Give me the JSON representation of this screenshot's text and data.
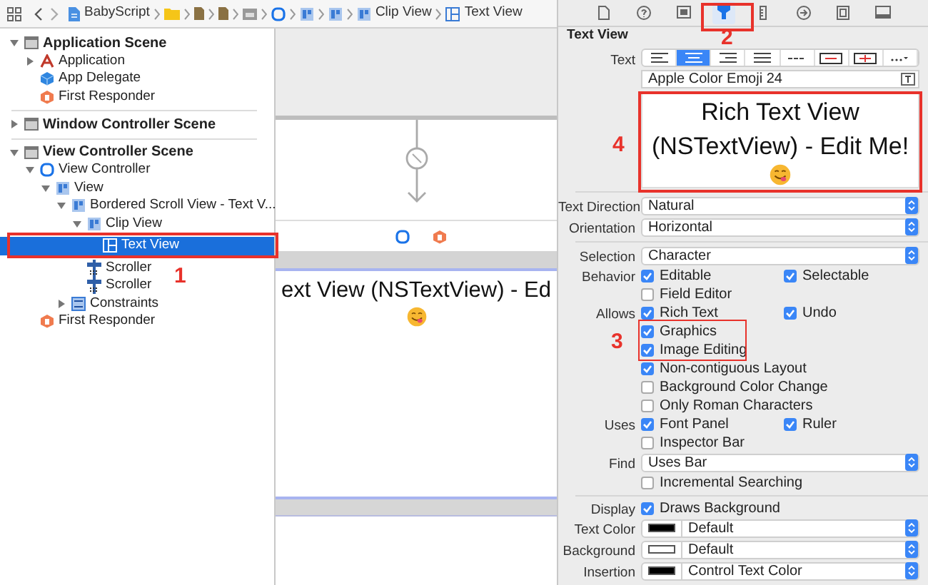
{
  "breadcrumbs": [
    {
      "kind": "project",
      "label": "BabyScript"
    },
    {
      "kind": "folder"
    },
    {
      "kind": "file"
    },
    {
      "kind": "file"
    },
    {
      "kind": "storyboard"
    },
    {
      "kind": "controller"
    },
    {
      "kind": "view"
    },
    {
      "kind": "view"
    },
    {
      "kind": "view",
      "label": "Clip View"
    },
    {
      "kind": "textview",
      "label": "Text View"
    }
  ],
  "outline": [
    {
      "label": "Application Scene",
      "kind": "scene",
      "expanded": true,
      "selected": false,
      "children": [
        {
          "label": "Application",
          "kind": "app",
          "expanded": false,
          "selected": false
        },
        {
          "label": "App Delegate",
          "kind": "cube",
          "selected": false
        },
        {
          "label": "First Responder",
          "kind": "responder",
          "selected": false
        }
      ]
    },
    {
      "label": "Window Controller Scene",
      "kind": "scene",
      "expanded": false,
      "selected": false
    },
    {
      "label": "View Controller Scene",
      "kind": "scene",
      "expanded": true,
      "selected": false,
      "children": [
        {
          "label": "View Controller",
          "kind": "controller",
          "expanded": true,
          "selected": false,
          "children": [
            {
              "label": "View",
              "kind": "view",
              "expanded": true,
              "selected": false,
              "children": [
                {
                  "label": "Bordered Scroll View - Text V...",
                  "kind": "view",
                  "expanded": true,
                  "selected": false,
                  "children": [
                    {
                      "label": "Clip View",
                      "kind": "view",
                      "expanded": true,
                      "selected": false,
                      "children": [
                        {
                          "label": "Text View",
                          "kind": "textview",
                          "selected": true
                        }
                      ]
                    },
                    {
                      "label": "Scroller",
                      "kind": "scroller",
                      "selected": false
                    },
                    {
                      "label": "Scroller",
                      "kind": "scroller",
                      "selected": false
                    }
                  ]
                },
                {
                  "label": "Constraints",
                  "kind": "constraints",
                  "expanded": false,
                  "selected": false
                }
              ]
            }
          ]
        },
        {
          "label": "First Responder",
          "kind": "responder",
          "selected": false
        }
      ]
    }
  ],
  "canvas": {
    "text": "ext View (NSTextView) - Ed"
  },
  "inspector": {
    "tabs": [
      {
        "kind": "file",
        "selected": false
      },
      {
        "kind": "help",
        "selected": false
      },
      {
        "kind": "identity",
        "selected": false
      },
      {
        "kind": "attributes",
        "selected": true
      },
      {
        "kind": "size",
        "selected": false
      },
      {
        "kind": "connections",
        "selected": false
      },
      {
        "kind": "bindings",
        "selected": false
      },
      {
        "kind": "effects",
        "selected": false
      }
    ],
    "title": "Text View",
    "text_label": "Text",
    "alignment": [
      {
        "kind": "left",
        "selected": false
      },
      {
        "kind": "center",
        "selected": true
      },
      {
        "kind": "right",
        "selected": false
      },
      {
        "kind": "justify",
        "selected": false
      },
      {
        "kind": "natural",
        "selected": false
      },
      {
        "kind": "strike",
        "selected": false
      },
      {
        "kind": "underline",
        "selected": false
      },
      {
        "kind": "more",
        "selected": false
      }
    ],
    "font": "Apple Color Emoji 24",
    "preview": [
      "Rich Text View",
      "(NSTextView) - Edit Me!"
    ],
    "sections": [
      {
        "rows": [
          {
            "kind": "popup",
            "label": "Text Direction",
            "value": "Natural"
          },
          {
            "kind": "popup",
            "label": "Orientation",
            "value": "Horizontal"
          }
        ]
      },
      {
        "rows": [
          {
            "kind": "popup",
            "label": "Selection",
            "value": "Character"
          },
          {
            "kind": "checks",
            "label": "Behavior",
            "items": [
              {
                "label": "Editable",
                "checked": true
              },
              {
                "label": "Selectable",
                "checked": true
              }
            ]
          },
          {
            "kind": "checks",
            "items": [
              {
                "label": "Field Editor",
                "checked": false
              }
            ]
          },
          {
            "kind": "checks",
            "label": "Allows",
            "items": [
              {
                "label": "Rich Text",
                "checked": true
              },
              {
                "label": "Undo",
                "checked": true
              }
            ]
          },
          {
            "kind": "checks",
            "items": [
              {
                "label": "Graphics",
                "checked": true
              }
            ]
          },
          {
            "kind": "checks",
            "items": [
              {
                "label": "Image Editing",
                "checked": true
              }
            ]
          },
          {
            "kind": "checks",
            "items": [
              {
                "label": "Non-contiguous Layout",
                "checked": true
              }
            ]
          },
          {
            "kind": "checks",
            "items": [
              {
                "label": "Background Color Change",
                "checked": false
              }
            ]
          },
          {
            "kind": "checks",
            "items": [
              {
                "label": "Only Roman Characters",
                "checked": false
              }
            ]
          },
          {
            "kind": "checks",
            "label": "Uses",
            "items": [
              {
                "label": "Font Panel",
                "checked": true
              },
              {
                "label": "Ruler",
                "checked": true
              }
            ]
          },
          {
            "kind": "checks",
            "items": [
              {
                "label": "Inspector Bar",
                "checked": false
              }
            ]
          },
          {
            "kind": "popup",
            "label": "Find",
            "value": "Uses Bar"
          },
          {
            "kind": "checks",
            "items": [
              {
                "label": "Incremental Searching",
                "checked": false
              }
            ]
          }
        ]
      },
      {
        "rows": [
          {
            "kind": "checks",
            "label": "Display",
            "items": [
              {
                "label": "Draws Background",
                "checked": true
              }
            ]
          },
          {
            "kind": "color",
            "label": "Text Color",
            "color": "#000000",
            "value": "Default"
          },
          {
            "kind": "color",
            "label": "Background",
            "color": "#ffffff",
            "value": "Default"
          },
          {
            "kind": "color",
            "label": "Insertion",
            "color": "#000000",
            "value": "Control Text Color"
          }
        ]
      }
    ]
  },
  "annotations": [
    {
      "label": "1"
    },
    {
      "label": "2"
    },
    {
      "label": "3"
    },
    {
      "label": "4"
    }
  ]
}
